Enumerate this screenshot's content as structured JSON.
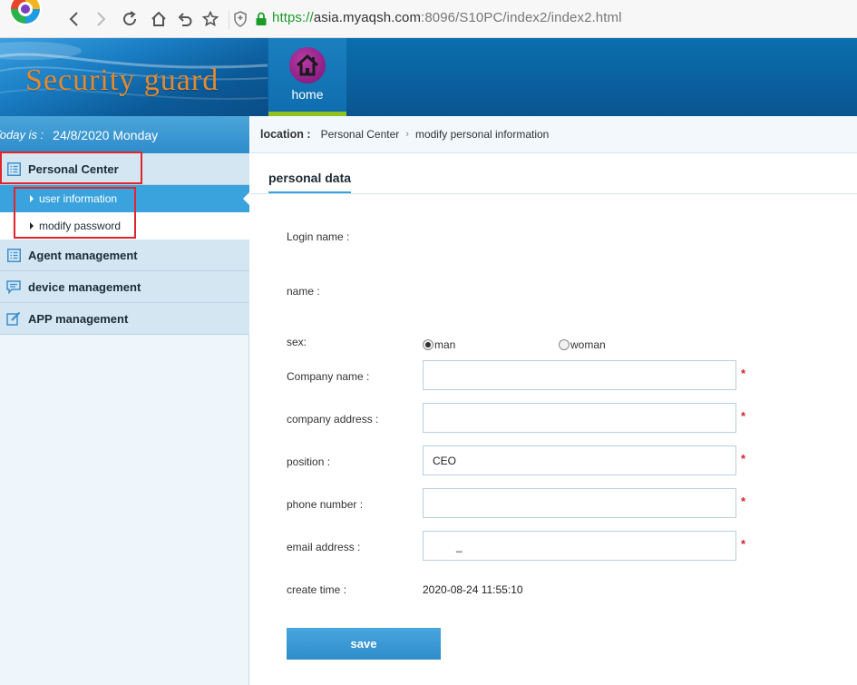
{
  "browser": {
    "url_scheme": "https://",
    "url_host": "asia.myaqsh.com",
    "url_rest": ":8096/S10PC/index2/index2.html"
  },
  "header": {
    "brand": "Security guard",
    "nav_home_label": "home",
    "accent_color": "#8dc21f"
  },
  "sidebar": {
    "date_label": "Today is :",
    "date_value": "24/8/2020 Monday",
    "groups": [
      {
        "label": "Personal Center",
        "icon": "list-icon"
      },
      {
        "label": "Agent management",
        "icon": "list-icon"
      },
      {
        "label": "device management",
        "icon": "message-icon"
      },
      {
        "label": "APP management",
        "icon": "edit-icon"
      }
    ],
    "sub_items": [
      {
        "label": "user information",
        "active": true
      },
      {
        "label": "modify password",
        "active": false
      }
    ]
  },
  "breadcrumb": {
    "label": "location :",
    "items": [
      "Personal Center",
      "modify personal information"
    ]
  },
  "form": {
    "tab_title": "personal data",
    "login_name_label": "Login name :",
    "name_label": "name :",
    "sex_label": "sex:",
    "sex_options": [
      {
        "label": "man",
        "checked": true
      },
      {
        "label": "woman",
        "checked": false
      }
    ],
    "company_name_label": "Company name :",
    "company_name_value": "",
    "company_address_label": "company address :",
    "company_address_value": "",
    "position_label": "position :",
    "position_value": "CEO",
    "phone_label": "phone number :",
    "phone_value": "",
    "email_label": "email address :",
    "email_value": "_",
    "create_time_label": "create time :",
    "create_time_value": "2020-08-24 11:55:10",
    "required_mark": "*",
    "save_label": "save"
  }
}
